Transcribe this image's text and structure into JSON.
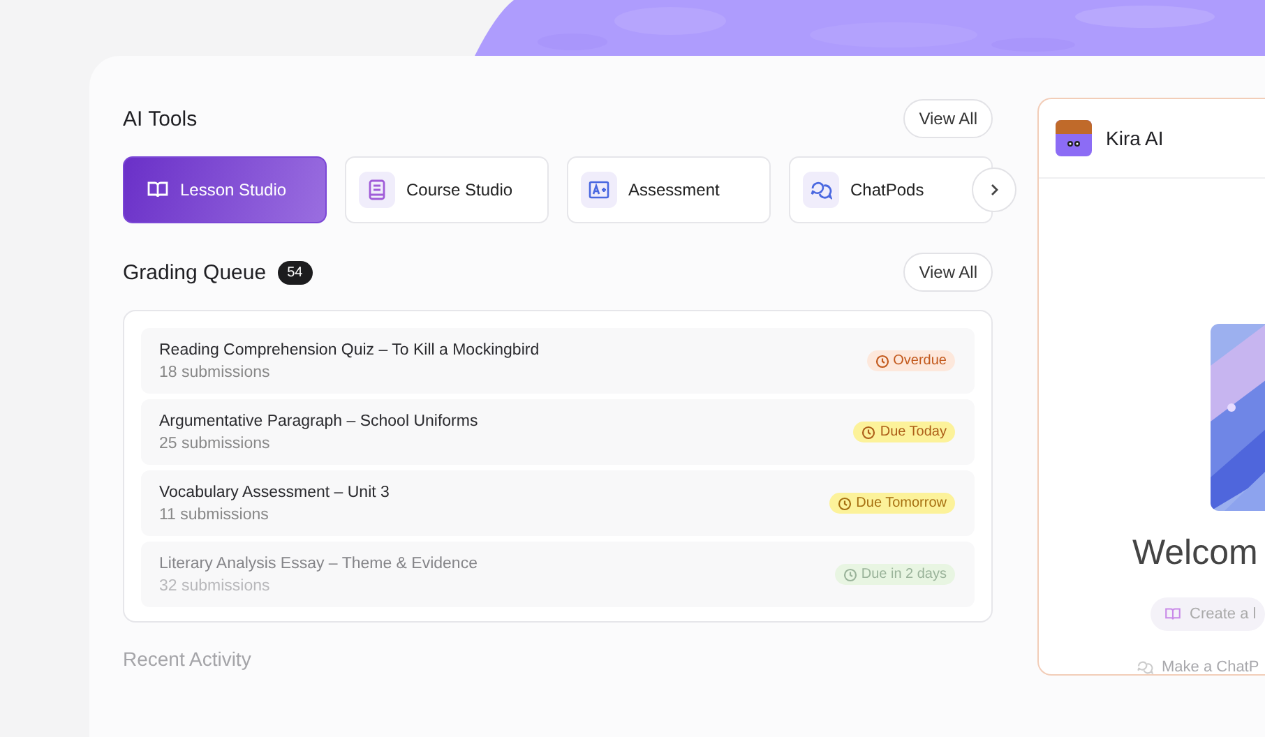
{
  "tools": {
    "title": "AI Tools",
    "view_all": "View All",
    "items": [
      {
        "label": "Lesson Studio",
        "kind": "book",
        "selected": true
      },
      {
        "label": "Course Studio",
        "kind": "notebook",
        "selected": false
      },
      {
        "label": "Assessment",
        "kind": "grade",
        "selected": false
      },
      {
        "label": "ChatPods",
        "kind": "chat",
        "selected": false
      }
    ]
  },
  "grading_queue": {
    "title": "Grading Queue",
    "count": "54",
    "view_all": "View All",
    "rows": [
      {
        "title": "Reading Comprehension Quiz – To Kill a Mockingbird",
        "submissions": "18 submissions",
        "status": "Overdue",
        "kind": "overdue"
      },
      {
        "title": "Argumentative Paragraph – School Uniforms",
        "submissions": "25 submissions",
        "status": "Due Today",
        "kind": "today"
      },
      {
        "title": "Vocabulary Assessment – Unit 3",
        "submissions": "11 submissions",
        "status": "Due Tomorrow",
        "kind": "tomorrow"
      },
      {
        "title": "Literary Analysis Essay – Theme & Evidence",
        "submissions": "32 submissions",
        "status": "Due in 2 days",
        "kind": "later"
      }
    ]
  },
  "recent_activity": {
    "title": "Recent Activity"
  },
  "assistant": {
    "name": "Kira AI",
    "welcome": "Welcom",
    "suggestions": [
      {
        "label": "Create a l",
        "kind": "book"
      },
      {
        "label": "Make a ChatP",
        "kind": "chat"
      }
    ]
  }
}
